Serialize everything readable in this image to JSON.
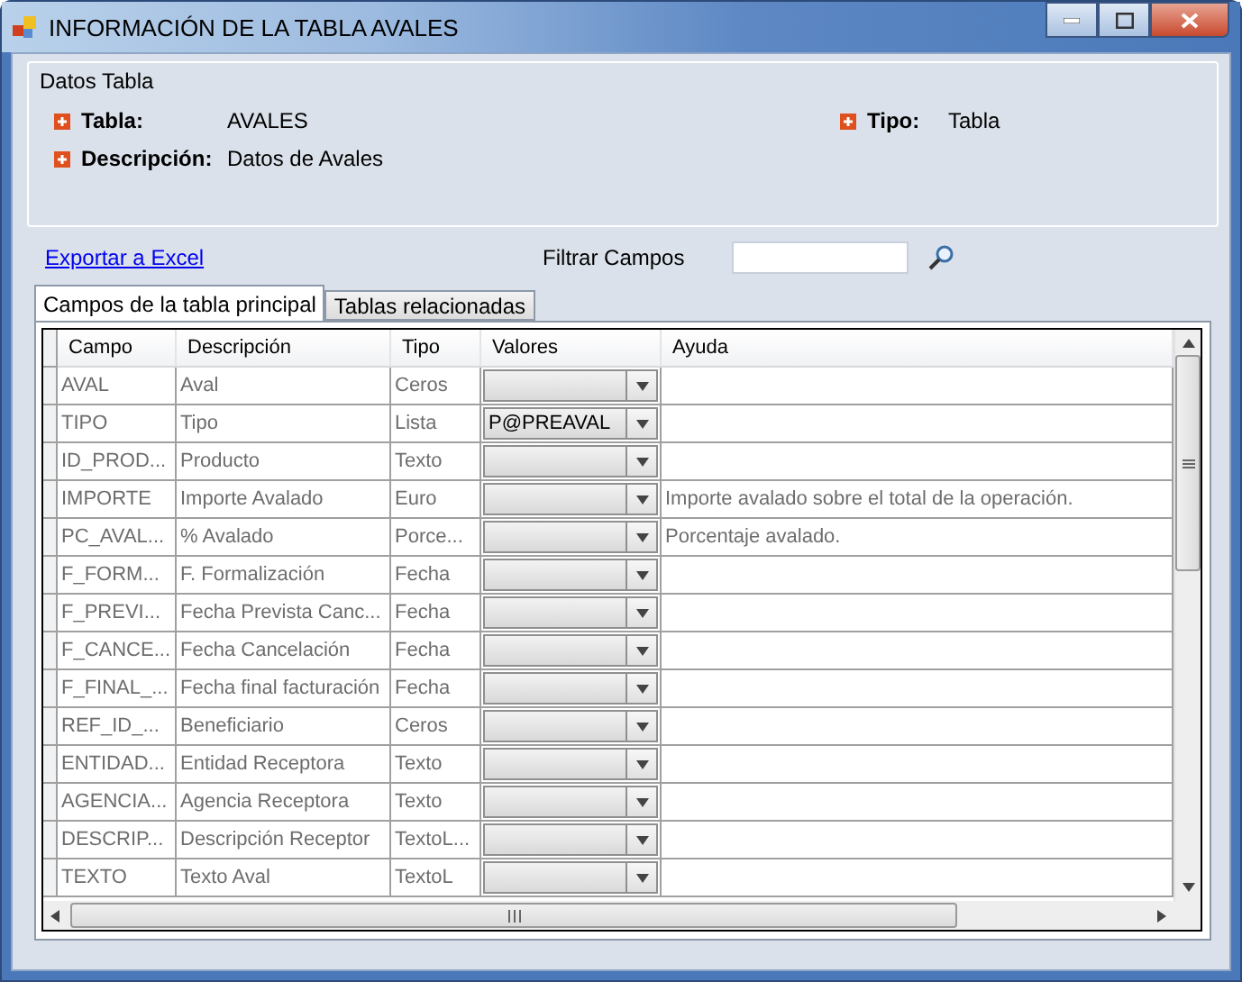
{
  "window": {
    "title": "INFORMACIÓN DE LA TABLA AVALES"
  },
  "group": {
    "title": "Datos Tabla",
    "fields": [
      {
        "label": "Tabla:",
        "value": "AVALES"
      },
      {
        "label": "Descripción:",
        "value": "Datos de Avales"
      },
      {
        "label": "Tipo:",
        "value": "Tabla"
      }
    ]
  },
  "export_link": "Exportar a Excel",
  "filter": {
    "label": "Filtrar Campos"
  },
  "tabs": [
    {
      "label": "Campos de la tabla principal",
      "selected": true
    },
    {
      "label": "Tablas relacionadas",
      "selected": false
    }
  ],
  "table": {
    "columns": [
      "Campo",
      "Descripción",
      "Tipo",
      "Valores",
      "Ayuda"
    ],
    "rows": [
      {
        "campo": "AVAL",
        "descripcion": "Aval",
        "tipo": "Ceros",
        "valores": "",
        "ayuda": ""
      },
      {
        "campo": "TIPO",
        "descripcion": "Tipo",
        "tipo": "Lista",
        "valores": "P@PREAVAL",
        "ayuda": ""
      },
      {
        "campo": "ID_PROD...",
        "descripcion": "Producto",
        "tipo": "Texto",
        "valores": "",
        "ayuda": ""
      },
      {
        "campo": "IMPORTE",
        "descripcion": "Importe Avalado",
        "tipo": "Euro",
        "valores": "",
        "ayuda": "Importe avalado sobre el total de la operación."
      },
      {
        "campo": "PC_AVAL...",
        "descripcion": "% Avalado",
        "tipo": "Porce...",
        "valores": "",
        "ayuda": "Porcentaje avalado."
      },
      {
        "campo": "F_FORM...",
        "descripcion": "F. Formalización",
        "tipo": "Fecha",
        "valores": "",
        "ayuda": ""
      },
      {
        "campo": "F_PREVI...",
        "descripcion": "Fecha Prevista Canc...",
        "tipo": "Fecha",
        "valores": "",
        "ayuda": ""
      },
      {
        "campo": "F_CANCE...",
        "descripcion": "Fecha Cancelación",
        "tipo": "Fecha",
        "valores": "",
        "ayuda": ""
      },
      {
        "campo": "F_FINAL_...",
        "descripcion": "Fecha final facturación",
        "tipo": "Fecha",
        "valores": "",
        "ayuda": ""
      },
      {
        "campo": "REF_ID_...",
        "descripcion": "Beneficiario",
        "tipo": "Ceros",
        "valores": "",
        "ayuda": ""
      },
      {
        "campo": "ENTIDAD...",
        "descripcion": "Entidad Receptora",
        "tipo": "Texto",
        "valores": "",
        "ayuda": ""
      },
      {
        "campo": "AGENCIA...",
        "descripcion": "Agencia Receptora",
        "tipo": "Texto",
        "valores": "",
        "ayuda": ""
      },
      {
        "campo": "DESCRIP...",
        "descripcion": "Descripción Receptor",
        "tipo": "TextoL...",
        "valores": "",
        "ayuda": ""
      },
      {
        "campo": "TEXTO",
        "descripcion": "Texto Aval",
        "tipo": "TextoL",
        "valores": "",
        "ayuda": ""
      }
    ]
  }
}
